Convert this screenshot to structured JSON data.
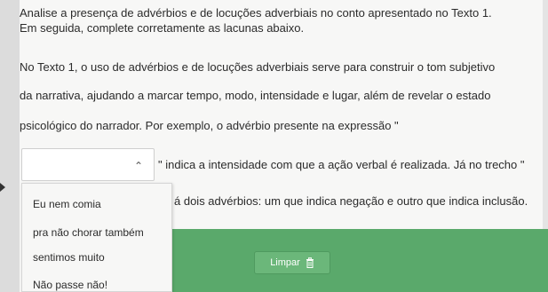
{
  "instruction": {
    "line1": "Analise a presença de advérbios e de locuções adverbiais no conto apresentado no Texto 1.",
    "line2": "Em seguida, complete corretamente as lacunas abaixo."
  },
  "paragraph": {
    "line1": "No Texto 1, o uso de advérbios e de locuções adverbiais serve para construir o tom subjetivo",
    "line2": "da narrativa, ajudando a marcar tempo, modo, intensidade e lugar, além de revelar o estado",
    "line3": "psicológico do narrador. Por exemplo, o advérbio presente na expressão \"",
    "line4": "\" indica a intensidade com que a ação verbal é realizada. Já no trecho \"",
    "line5": "á dois advérbios: um que indica negação e outro que indica inclusão."
  },
  "dropdown": {
    "chevron_icon": "chevron-up-icon",
    "options": [
      "Eu nem comia",
      "pra não chorar também",
      "sentimos muito",
      "Não passe não!"
    ]
  },
  "actions": {
    "clear_label": "Limpar",
    "clear_icon": "trash-icon"
  },
  "colors": {
    "accent_green": "#5aa96b",
    "button_green": "#6bb77a"
  }
}
